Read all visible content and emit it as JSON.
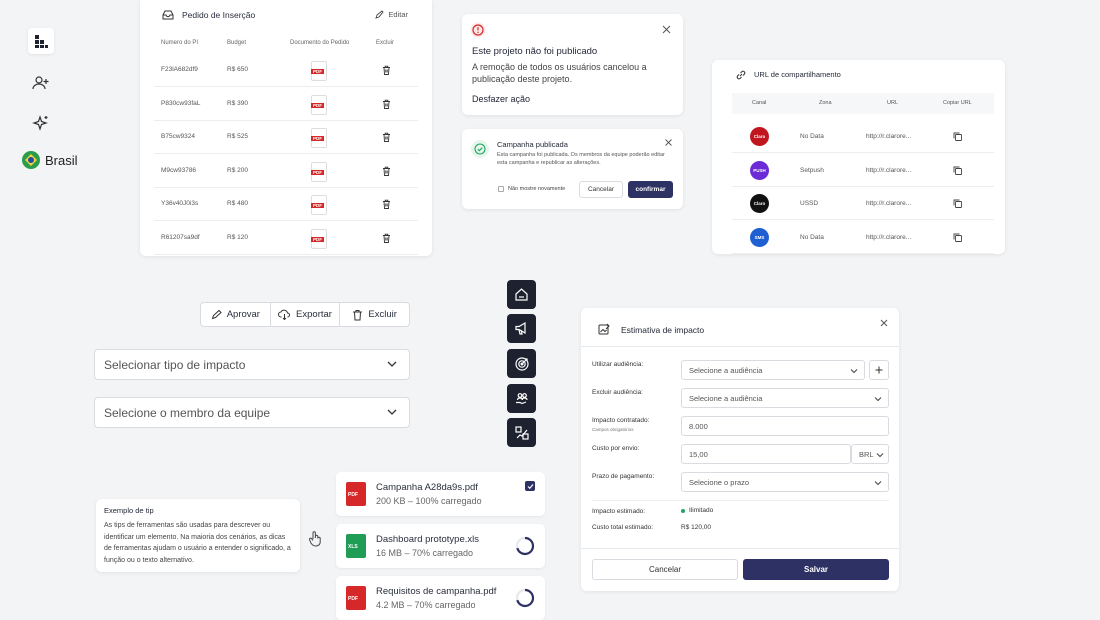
{
  "rail": {
    "country": "Brasil"
  },
  "pi_table": {
    "title": "Pedido de Inserção",
    "edit_label": "Editar",
    "headers": [
      "Numero do PI",
      "Budget",
      "Documento do Pedido",
      "Excluir"
    ],
    "rows": [
      {
        "pi": "F23lA682df9",
        "budget": "R$ 650"
      },
      {
        "pi": "P830cw93faL",
        "budget": "R$ 390"
      },
      {
        "pi": "B75cw9324",
        "budget": "R$ 525"
      },
      {
        "pi": "M9cw93786",
        "budget": "R$ 200"
      },
      {
        "pi": "Y36v40J0i3s",
        "budget": "R$ 480"
      },
      {
        "pi": "R61207sa9df",
        "budget": "R$ 120"
      }
    ]
  },
  "toast_unpublished": {
    "title": "Este projeto não foi publicado",
    "body": "A remoção de todos os usuários cancelou a publicação deste projeto.",
    "action": "Desfazer ação"
  },
  "toast_published": {
    "title": "Campanha publicada",
    "body": "Esta campanha foi publicada. Os membros da equipe poderão editar esta campanha e republicar as alterações.",
    "checkbox": "Não mostre novamente",
    "cancel": "Cancelar",
    "confirm": "confirmar"
  },
  "share": {
    "title": "URL de compartilhamento",
    "headers": [
      "Canal",
      "Zona",
      "URL",
      "Copiar URL"
    ],
    "rows": [
      {
        "channel": "Claro",
        "zone": "No Data",
        "url": "http://r.clarore..."
      },
      {
        "channel": "PUSH",
        "zone": "Setpush",
        "url": "http://r.clarore..."
      },
      {
        "channel": "Claro",
        "zone": "USSD",
        "url": "http://r.clarore..."
      },
      {
        "channel": "SMS",
        "zone": "No Data",
        "url": "http://r.clarore..."
      }
    ]
  },
  "actions": {
    "approve": "Aprovar",
    "export": "Exportar",
    "delete": "Excluir"
  },
  "selects": {
    "impact_type": "Selecionar tipo de impacto",
    "team_member": "Selecione o membro da equipe"
  },
  "files": [
    {
      "name": "Campanha A28da9s.pdf",
      "size": "200 KB – 100% carregado",
      "type": "PDF",
      "progress": 1.0
    },
    {
      "name": "Dashboard prototype.xls",
      "size": "16 MB – 70% carregado",
      "type": "XLS",
      "progress": 0.7
    },
    {
      "name": "Requisitos de campanha.pdf",
      "size": "4.2 MB – 70% carregado",
      "type": "PDF",
      "progress": 0.7
    }
  ],
  "tooltip": {
    "title": "Exemplo de tip",
    "body": "As tips de ferramentas são usadas para descrever ou identificar um elemento. Na maioria dos cenários, as dicas de ferramentas ajudam o usuário a entender o significado, a função ou o texto alternativo."
  },
  "modal": {
    "title": "Estimativa de impacto",
    "use_audience_label": "Utilizar audiência:",
    "use_audience_placeholder": "Selecione a audiência",
    "exclude_audience_label": "Excluir audiência:",
    "exclude_audience_placeholder": "Selecione a audiência",
    "contracted_label": "Impacto contratado:",
    "contracted_sub": "Campos obrigatórios",
    "contracted_value": "8.000",
    "cost_label": "Custo por envio:",
    "cost_value": "15,00",
    "currency": "BRL",
    "term_label": "Prazo de pagamento:",
    "term_placeholder": "Selecione o prazo",
    "estimated_label": "Impacto estimado:",
    "estimated_value": "Ilimitado",
    "total_label": "Custo total estimado:",
    "total_value": "R$ 120,00",
    "cancel": "Cancelar",
    "save": "Salvar"
  },
  "colors": {
    "primary": "#2d3163",
    "dark": "#1e2130",
    "success": "#22a45d",
    "pdf": "#d62828",
    "xls": "#1f9d55"
  }
}
